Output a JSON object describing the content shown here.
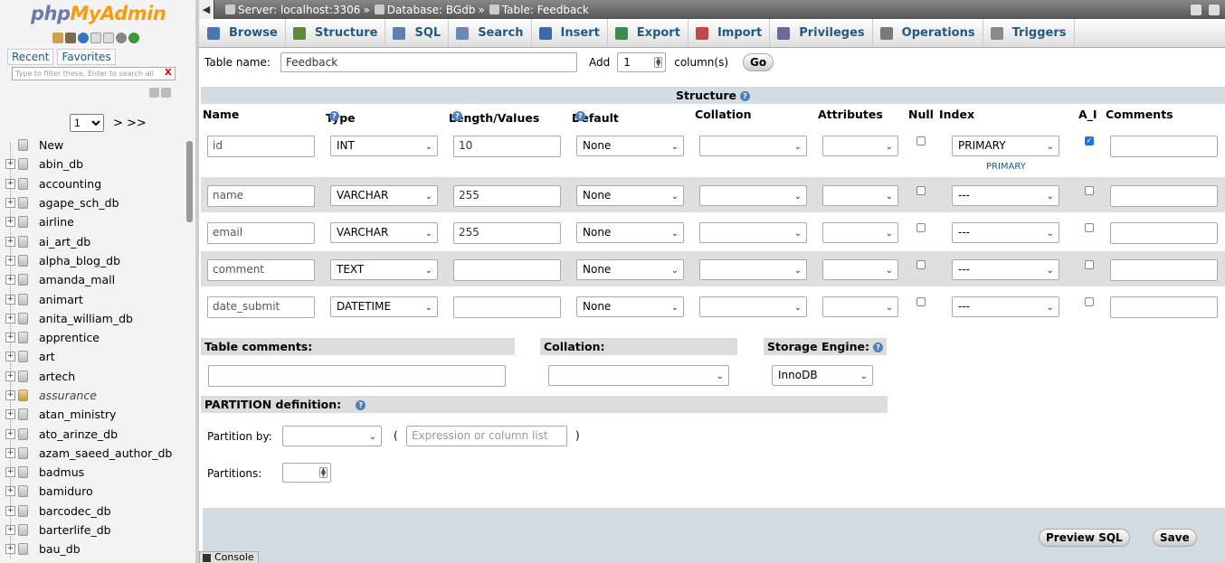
{
  "nav": {
    "logo_php": "php",
    "logo_my": "MyAdmin",
    "tabs": [
      "Recent",
      "Favorites"
    ],
    "filter_placeholder": "Type to filter these, Enter to search all",
    "filter_clear": "X",
    "page_value": "1",
    "page_next": "> >>",
    "databases": [
      {
        "name": "New",
        "type": "new"
      },
      {
        "name": "abin_db"
      },
      {
        "name": "accounting"
      },
      {
        "name": "agape_sch_db"
      },
      {
        "name": "airline"
      },
      {
        "name": "ai_art_db"
      },
      {
        "name": "alpha_blog_db"
      },
      {
        "name": "amanda_mall"
      },
      {
        "name": "animart"
      },
      {
        "name": "anita_william_db"
      },
      {
        "name": "apprentice"
      },
      {
        "name": "art"
      },
      {
        "name": "artech"
      },
      {
        "name": "assurance",
        "type": "italic"
      },
      {
        "name": "atan_ministry"
      },
      {
        "name": "ato_arinze_db"
      },
      {
        "name": "azam_saeed_author_db"
      },
      {
        "name": "badmus"
      },
      {
        "name": "bamiduro"
      },
      {
        "name": "barcodec_db"
      },
      {
        "name": "barterlife_db"
      },
      {
        "name": "bau_db"
      }
    ]
  },
  "breadcrumb": {
    "server": "Server: localhost:3306",
    "database": "Database: BGdb",
    "table": "Table: Feedback",
    "separator": "»"
  },
  "tabs": [
    "Browse",
    "Structure",
    "SQL",
    "Search",
    "Insert",
    "Export",
    "Import",
    "Privileges",
    "Operations",
    "Triggers"
  ],
  "form": {
    "table_name_label": "Table name:",
    "table_name_value": "Feedback",
    "add_label": "Add",
    "add_value": "1",
    "columns_label": "column(s)",
    "go_label": "Go",
    "structure_title": "Structure",
    "headers": {
      "name": "Name",
      "type": "Type",
      "length": "Length/Values",
      "default": "Default",
      "collation": "Collation",
      "attributes": "Attributes",
      "null": "Null",
      "index": "Index",
      "ai": "A_I",
      "comments": "Comments"
    },
    "fields": [
      {
        "name": "id",
        "type": "INT",
        "length": "10",
        "default": "None",
        "index": "PRIMARY",
        "ai": true,
        "index_note": "PRIMARY"
      },
      {
        "name": "name",
        "type": "VARCHAR",
        "length": "255",
        "default": "None",
        "index": "---",
        "ai": false
      },
      {
        "name": "email",
        "type": "VARCHAR",
        "length": "255",
        "default": "None",
        "index": "---",
        "ai": false
      },
      {
        "name": "comment",
        "type": "TEXT",
        "length": "",
        "default": "None",
        "index": "---",
        "ai": false
      },
      {
        "name": "date_submit",
        "type": "DATETIME",
        "length": "",
        "default": "None",
        "index": "---",
        "ai": false
      }
    ],
    "table_comments_label": "Table comments:",
    "collation_label": "Collation:",
    "storage_engine_label": "Storage Engine:",
    "storage_engine_value": "InnoDB",
    "partition_label": "PARTITION definition:",
    "partition_by_label": "Partition by:",
    "expression_placeholder": "Expression or column list",
    "paren_open": "(",
    "paren_close": ")",
    "partitions_label": "Partitions:",
    "preview_sql_label": "Preview SQL",
    "save_label": "Save"
  },
  "console_label": "Console",
  "colors": {
    "link": "#235a81",
    "header_bg": "#d3dce3",
    "logo_php": "#6c78af",
    "logo_my": "#f89c0e"
  }
}
